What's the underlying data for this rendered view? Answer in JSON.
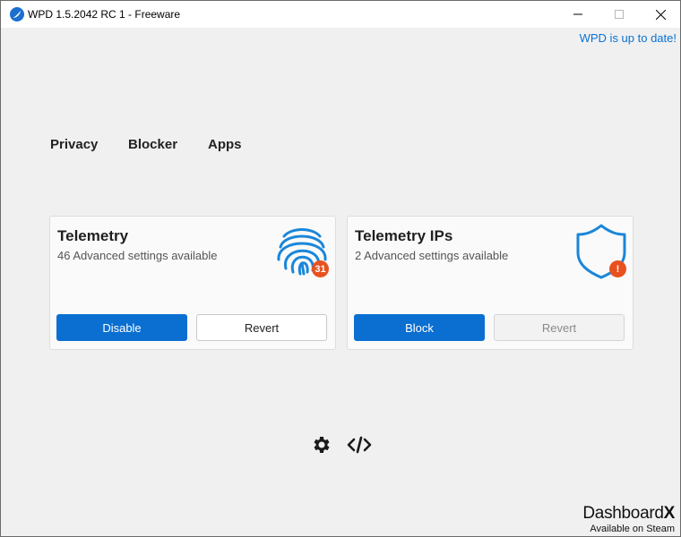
{
  "window": {
    "title": "WPD 1.5.2042 RC 1 - Freeware",
    "controls": [
      "minimize-icon",
      "maximize-icon",
      "close-icon"
    ]
  },
  "update_status": "WPD is up to date!",
  "nav": {
    "items": [
      {
        "label": "Privacy"
      },
      {
        "label": "Blocker"
      },
      {
        "label": "Apps"
      }
    ]
  },
  "cards": [
    {
      "title": "Telemetry",
      "subtitle": "46 Advanced settings available",
      "icon": "fingerprint-icon",
      "badge": "31",
      "primary_button": "Disable",
      "secondary_button": "Revert",
      "secondary_enabled": true
    },
    {
      "title": "Telemetry IPs",
      "subtitle": "2 Advanced settings available",
      "icon": "shield-icon",
      "badge": "!",
      "primary_button": "Block",
      "secondary_button": "Revert",
      "secondary_enabled": false
    }
  ],
  "footer": {
    "icons": [
      "settings-gear-icon",
      "code-icon"
    ],
    "brand_name_a": "Dashboard",
    "brand_name_b": "X",
    "brand_subtitle": "Available on Steam"
  },
  "colors": {
    "accent": "#0a6fd1",
    "link": "#0a73d4",
    "icon_blue": "#1a86d9",
    "badge": "#e8511e",
    "background": "#f0f0f0"
  }
}
